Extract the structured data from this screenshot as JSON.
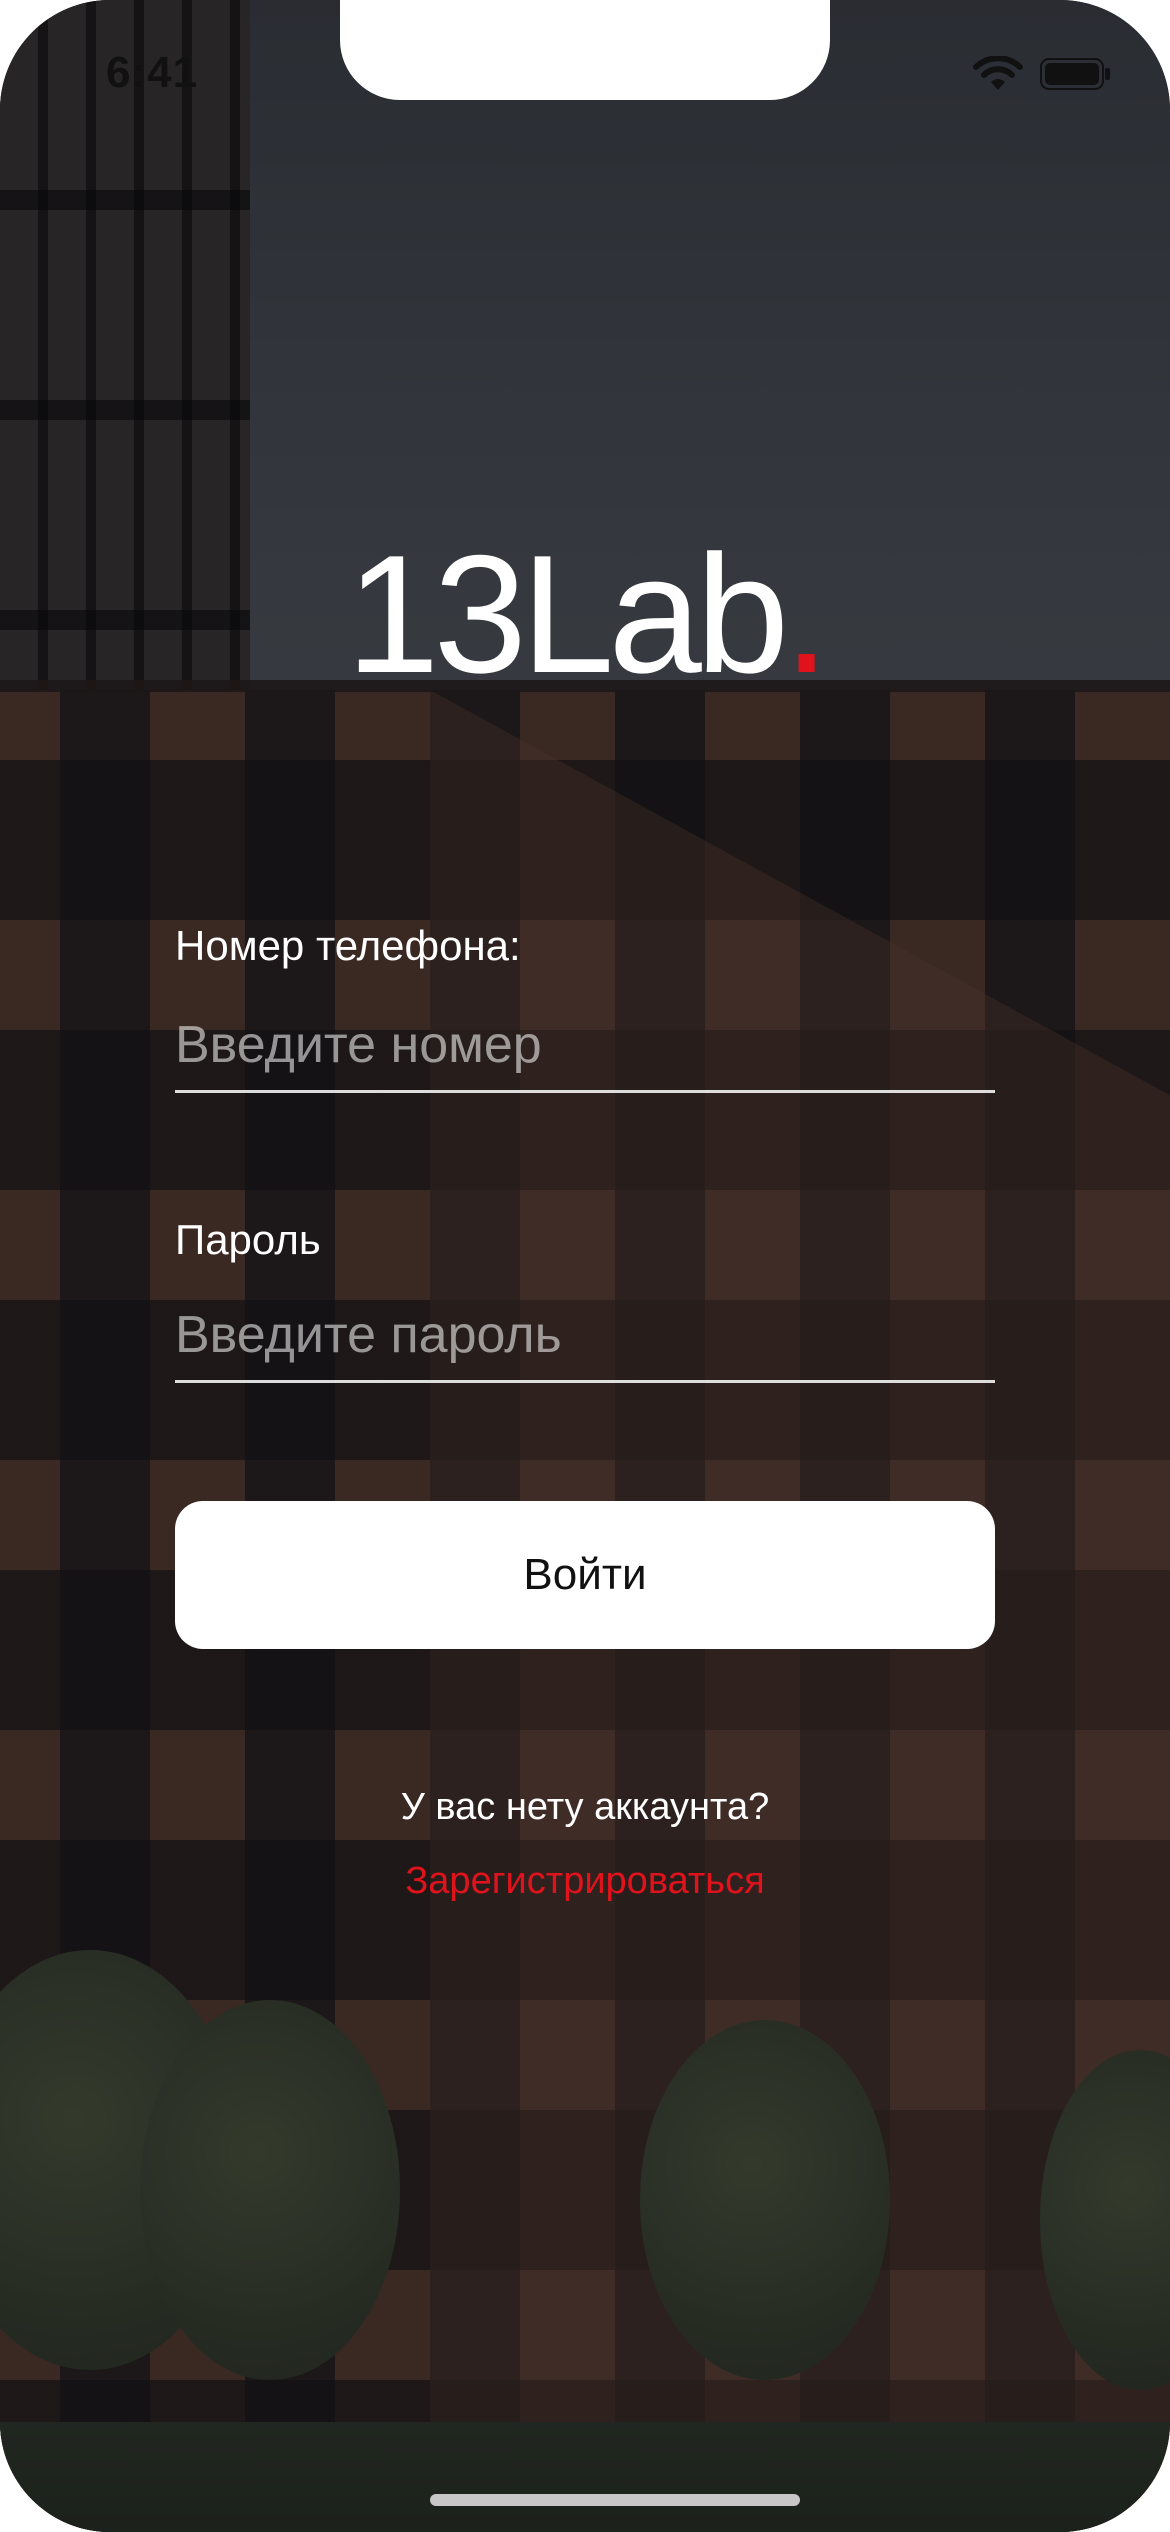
{
  "status_bar": {
    "time": "6:41",
    "icons": [
      "wifi-icon",
      "battery-icon"
    ]
  },
  "logo": {
    "text": "13Lab",
    "dot": ".",
    "dot_color": "#e0121c"
  },
  "form": {
    "phone": {
      "label": "Номер телефона:",
      "placeholder": "Введите номер"
    },
    "password": {
      "label": "Пароль",
      "placeholder": "Введите пароль"
    },
    "submit_label": "Войти"
  },
  "footer": {
    "question": "У вас нету аккаунта?",
    "register_label": "Зарегистрироваться",
    "accent_color": "#e0121c"
  }
}
